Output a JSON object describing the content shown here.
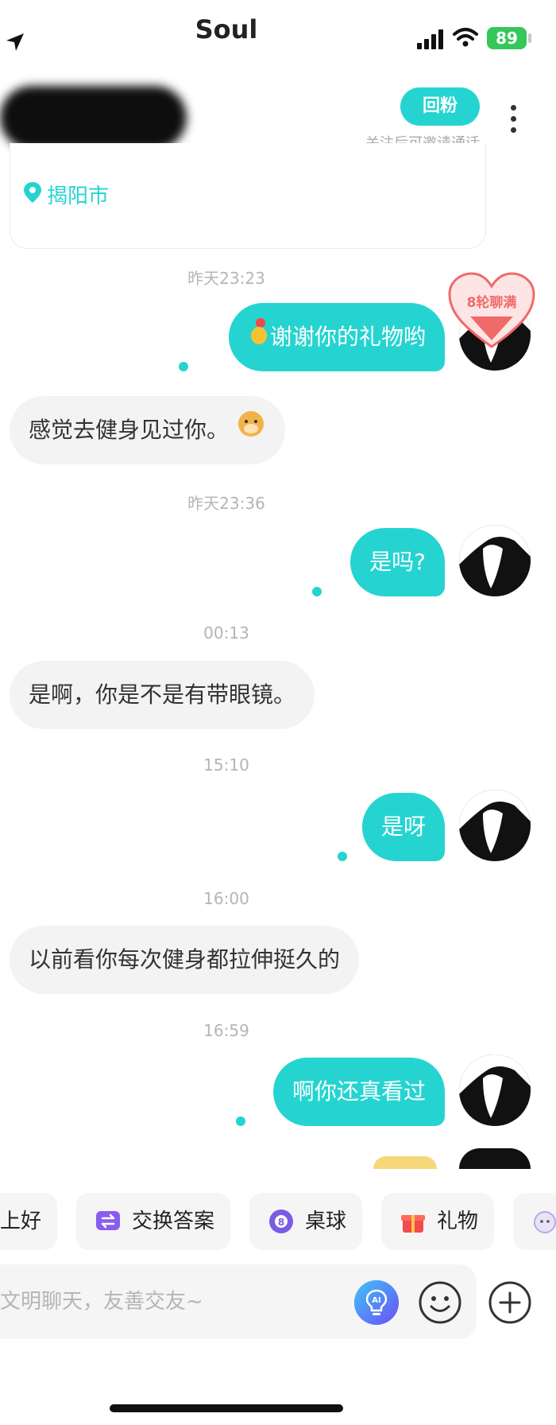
{
  "status_bar": {
    "app_name": "Soul",
    "battery": "89"
  },
  "header": {
    "follow_button": "回粉",
    "follow_hint": "关注后可邀请通话"
  },
  "profile_card": {
    "city": "揭阳市"
  },
  "heart_badge": {
    "text": "8轮聊满"
  },
  "messages": [
    {
      "time": "昨天23:23"
    },
    {
      "from": "me",
      "text": "谢谢你的礼物哟"
    },
    {
      "from": "them",
      "text": "感觉去健身见过你。"
    },
    {
      "time": "昨天23:36"
    },
    {
      "from": "me",
      "text": "是吗?"
    },
    {
      "time": "00:13"
    },
    {
      "from": "them",
      "text": "是啊，你是不是有带眼镜。"
    },
    {
      "time": "15:10"
    },
    {
      "from": "me",
      "text": "是呀"
    },
    {
      "time": "16:00"
    },
    {
      "from": "them",
      "text": "以前看你每次健身都拉伸挺久的"
    },
    {
      "time": "16:59"
    },
    {
      "from": "me",
      "text": "啊你还真看过"
    }
  ],
  "quick_actions": [
    "上好",
    "交换答案",
    "桌球",
    "礼物"
  ],
  "input": {
    "placeholder": "文明聊天，友善交友~"
  },
  "colors": {
    "accent": "#25d4d0",
    "bubble_in": "#f3f3f4",
    "badge_red": "#f06a6a"
  },
  "icons": [
    "location-arrow-icon",
    "signal-icon",
    "wifi-icon",
    "battery-icon",
    "more-vertical-icon",
    "pin-icon",
    "heart-badge-icon",
    "avatar-image",
    "ai-icon",
    "smile-icon",
    "plus-icon",
    "swap-icon",
    "billiards-icon",
    "gift-icon"
  ]
}
